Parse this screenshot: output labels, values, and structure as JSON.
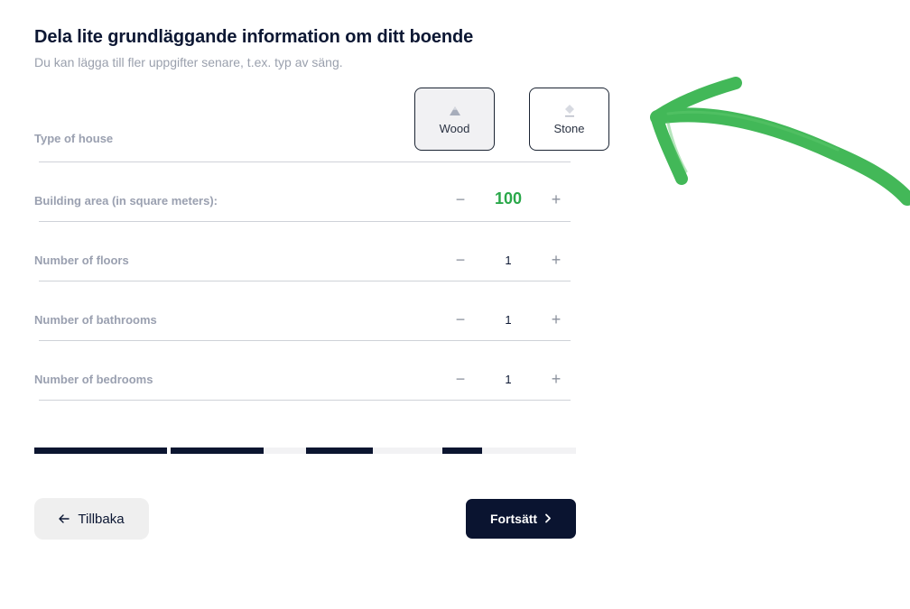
{
  "header": {
    "title": "Dela lite grundläggande information om ditt boende",
    "subtitle": "Du kan lägga till fler uppgifter senare, t.ex. typ av säng."
  },
  "house_type": {
    "label": "Type of house",
    "options": [
      {
        "label": "Wood",
        "icon": "mountain-icon",
        "selected": true
      },
      {
        "label": "Stone",
        "icon": "gem-icon",
        "selected": false
      }
    ]
  },
  "fields": [
    {
      "label": "Building area (in square meters):",
      "value": "100",
      "minus": "−",
      "plus": "+"
    },
    {
      "label": "Number of floors",
      "value": "1",
      "minus": "−",
      "plus": "+"
    },
    {
      "label": "Number of bathrooms",
      "value": "1",
      "minus": "−",
      "plus": "+"
    },
    {
      "label": "Number of bedrooms",
      "value": "1",
      "minus": "−",
      "plus": "+"
    }
  ],
  "progress": {
    "segments_filled": [
      true,
      true,
      false,
      true,
      false,
      true,
      false
    ]
  },
  "buttons": {
    "back_label": "Tillbaka",
    "next_label": "Fortsätt"
  },
  "colors": {
    "primary": "#0a1430",
    "accent_green": "#2aa84a",
    "muted_text": "#9aa0b0",
    "divider": "#cfd2d8"
  }
}
